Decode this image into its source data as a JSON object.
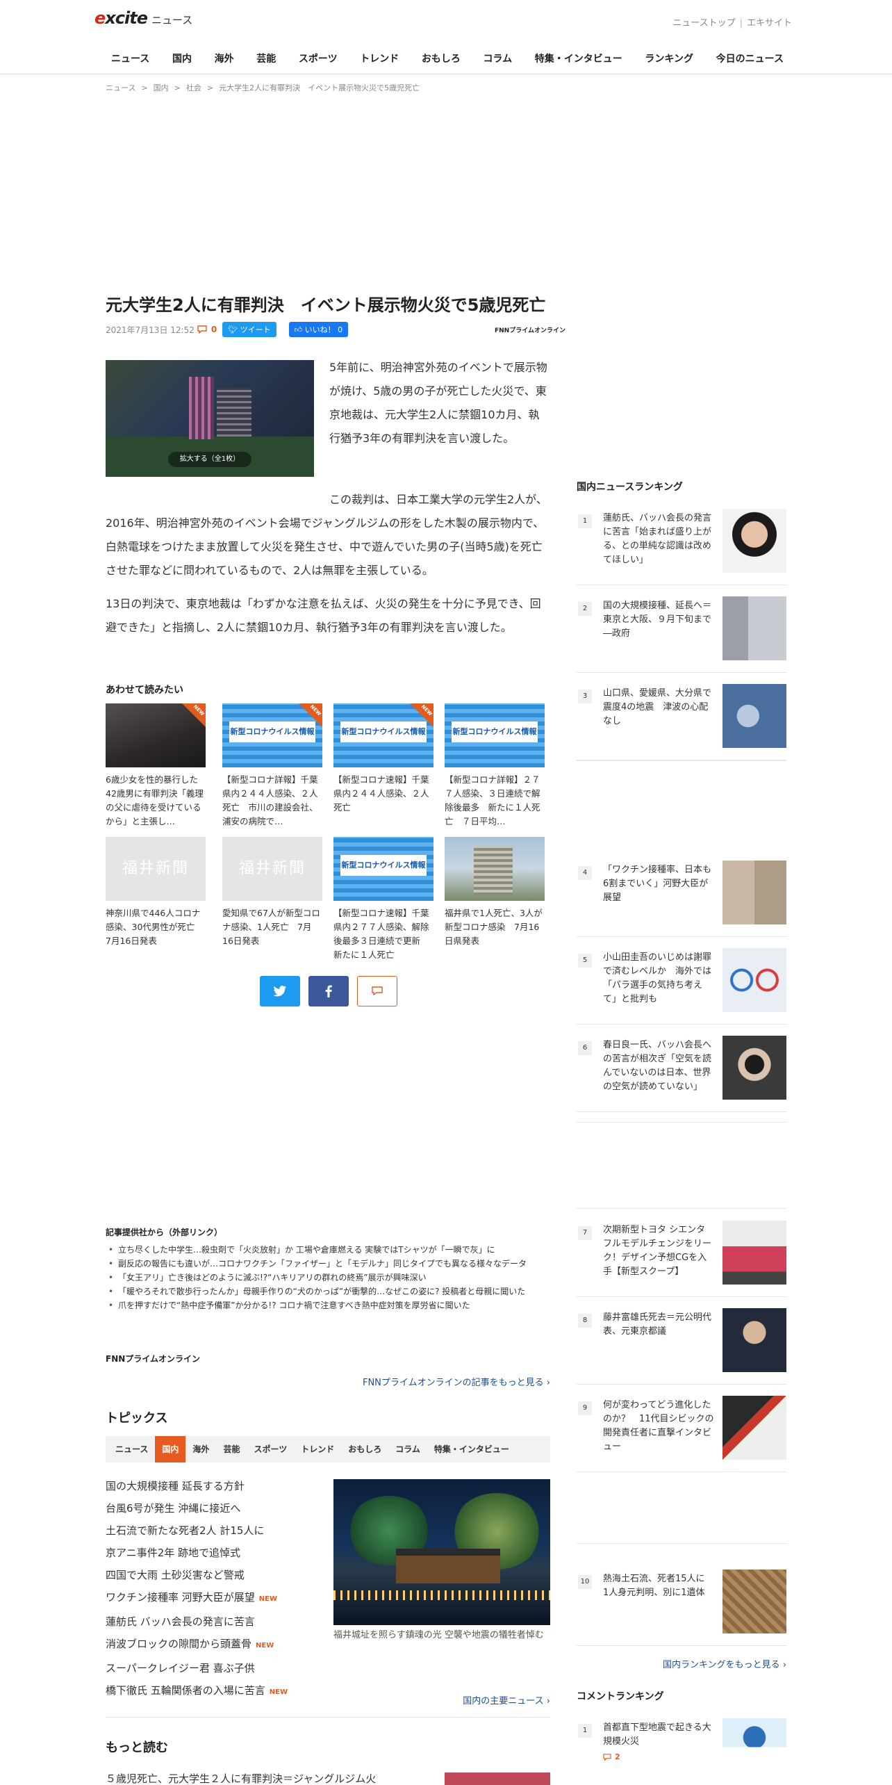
{
  "header": {
    "logo_brand": "excite",
    "logo_section": "ニュース",
    "top_links": [
      "ニューストップ",
      "エキサイト"
    ]
  },
  "nav": [
    "ニュース",
    "国内",
    "海外",
    "芸能",
    "スポーツ",
    "トレンド",
    "おもしろ",
    "コラム",
    "特集・インタビュー",
    "ランキング",
    "今日のニュース"
  ],
  "breadcrumb": [
    "ニュース",
    "国内",
    "社会",
    "元大学生2人に有罪判決　イベント展示物火災で5歳児死亡"
  ],
  "article": {
    "title": "元大学生2人に有罪判決　イベント展示物火災で5歳児死亡",
    "date": "2021年7月13日 12:52",
    "comment_count": "0",
    "tweet_label": "ツイート",
    "like_label": "いいね！ 0",
    "source_logo": "FNNプライムオンライン",
    "photo_button": "拡大する（全1枚）",
    "paragraphs": [
      "5年前に、明治神宮外苑のイベントで展示物が焼け、5歳の男の子が死亡した火災で、東京地裁は、元大学生2人に禁錮10カ月、執行猶予3年の有罪判決を言い渡した。",
      "この裁判は、日本工業大学の元学生2人が、2016年、明治神宮外苑のイベント会場でジャングルジムの形をした木製の展示物内で、白熱電球をつけたまま放置して火災を発生させ、中で遊んでいた男の子(当時5歳)を死亡させた罪などに問われているもので、2人は無罪を主張している。",
      "13日の判決で、東京地裁は「わずかな注意を払えば、火災の発生を十分に予見でき、回避できた」と指摘し、2人に禁錮10カ月、執行猶予3年の有罪判決を言い渡した。"
    ]
  },
  "related": {
    "heading": "あわせて読みたい",
    "new_label": "NEW",
    "corona_banner": "新型コロナウイルス情報",
    "fukui_banner": "福井新聞",
    "items": [
      {
        "title": "6歳少女を性的暴行した42歳男に有罪判決「義理の父に虐待を受けているから」と主張し…",
        "thumb": "dark",
        "new": true
      },
      {
        "title": "【新型コロナ詳報】千葉県内２４４人感染、２人死亡　市川の建設会社、浦安の病院で…",
        "thumb": "corona",
        "new": true
      },
      {
        "title": "【新型コロナ速報】千葉県内２４４人感染、２人死亡",
        "thumb": "corona",
        "new": true
      },
      {
        "title": "【新型コロナ詳報】２７７人感染、３日連続で解除後最多　新たに１人死亡　７日平均…",
        "thumb": "corona",
        "new": false
      },
      {
        "title": "神奈川県で446人コロナ感染、30代男性が死亡　7月16日発表",
        "thumb": "fukui",
        "new": false
      },
      {
        "title": "愛知県で67人が新型コロナ感染、1人死亡　7月16日発表",
        "thumb": "fukui",
        "new": false
      },
      {
        "title": "【新型コロナ速報】千葉県内２７７人感染、解除後最多３日連続で更新　新たに１人死亡",
        "thumb": "corona",
        "new": false
      },
      {
        "title": "福井県で1人死亡、3人が新型コロナ感染　7月16日県発表",
        "thumb": "bldg",
        "new": false
      }
    ]
  },
  "external": {
    "heading": "記事提供社から（外部リンク）",
    "items": [
      "立ち尽くした中学生…殺虫剤で「火炎放射」か 工場や倉庫燃える 実験ではTシャツが「一瞬で灰」に",
      "副反応の報告にも違いが…コロナワクチン「ファイザー」と「モデルナ」同じタイプでも異なる様々なデータ",
      "「女王アリ」亡き後はどのように滅ぶ!?“ハキリアリの群れの終焉”展示が興味深い",
      "「暖やろそれで散歩行ったんか」母親手作りの“犬のかっぱ”が衝撃的…なぜこの姿に? 投稿者と母親に聞いた",
      "爪を押すだけで“熱中症予備軍”か分かる!? コロナ禍で注意すべき熱中症対策を厚労省に聞いた"
    ],
    "source": "FNNプライムオンライン",
    "more": "FNNプライムオンラインの記事をもっと見る"
  },
  "topics": {
    "heading": "トピックス",
    "tabs": [
      "ニュース",
      "国内",
      "海外",
      "芸能",
      "スポーツ",
      "トレンド",
      "おもしろ",
      "コラム",
      "特集・インタビュー"
    ],
    "active_tab": "国内",
    "items": [
      {
        "text": "国の大規模接種 延長する方針",
        "new": false
      },
      {
        "text": "台風6号が発生 沖縄に接近へ",
        "new": false
      },
      {
        "text": "土石流で新たな死者2人 計15人に",
        "new": false
      },
      {
        "text": "京アニ事件2年 跡地で追悼式",
        "new": false
      },
      {
        "text": "四国で大雨 土砂災害など警戒",
        "new": false
      },
      {
        "text": "ワクチン接種率 河野大臣が展望",
        "new": true
      },
      {
        "text": "蓮舫氏 バッハ会長の発言に苦言",
        "new": false
      },
      {
        "text": "消波ブロックの隙間から頭蓋骨",
        "new": true
      },
      {
        "text": "スーパークレイジー君 喜ぶ子供",
        "new": false
      },
      {
        "text": "橋下徹氏 五輪関係者の入場に苦言",
        "new": true
      }
    ],
    "new_label": "NEW",
    "photo_caption": "福井城址を照らす鎮魂の光 空襲や地震の犠牲者悼む",
    "more": "国内の主要ニュース"
  },
  "more_read": {
    "heading": "もっと読む",
    "first": "５歳児死亡、元大学生２人に有罪判決＝ジャングルジム火"
  },
  "sidebar": {
    "ranking_heading": "国内ニュースランキング",
    "ranking": [
      {
        "num": "1",
        "title": "蓮舫氏、バッハ会長の発言に苦言「始まれば盛り上がる、との単純な認識は改めてほしい」"
      },
      {
        "num": "2",
        "title": "国の大規模接種、延長へ＝東京と大阪、９月下旬まで―政府"
      },
      {
        "num": "3",
        "title": "山口県、愛媛県、大分県で震度4の地震　津波の心配なし"
      },
      {
        "num": "4",
        "title": "「ワクチン接種率、日本も6割までいく」河野大臣が展望"
      },
      {
        "num": "5",
        "title": "小山田圭吾のいじめは謝罪で済むレベルか　海外では「パラ選手の気持ち考えて」と批判も"
      },
      {
        "num": "6",
        "title": "春日良一氏、バッハ会長への苦言が相次ぎ「空気を読んでいないのは日本、世界の空気が読めていない」"
      },
      {
        "num": "7",
        "title": "次期新型トヨタ シエンタ フルモデルチェンジをリーク！デザイン予想CGを入手【新型スクープ】"
      },
      {
        "num": "8",
        "title": "藤井富雄氏死去＝元公明代表、元東京都議"
      },
      {
        "num": "9",
        "title": "何が変わってどう進化したのか？　11代目シビックの開発責任者に直撃インタビュー"
      },
      {
        "num": "10",
        "title": "熱海土石流、死者15人に　1人身元判明、別に1遺体"
      }
    ],
    "ranking_more": "国内ランキングをもっと見る",
    "comment_heading": "コメントランキング",
    "comment_ranking": [
      {
        "num": "1",
        "title": "首都直下型地震で起きる大規模火災",
        "comments": "2"
      }
    ]
  }
}
